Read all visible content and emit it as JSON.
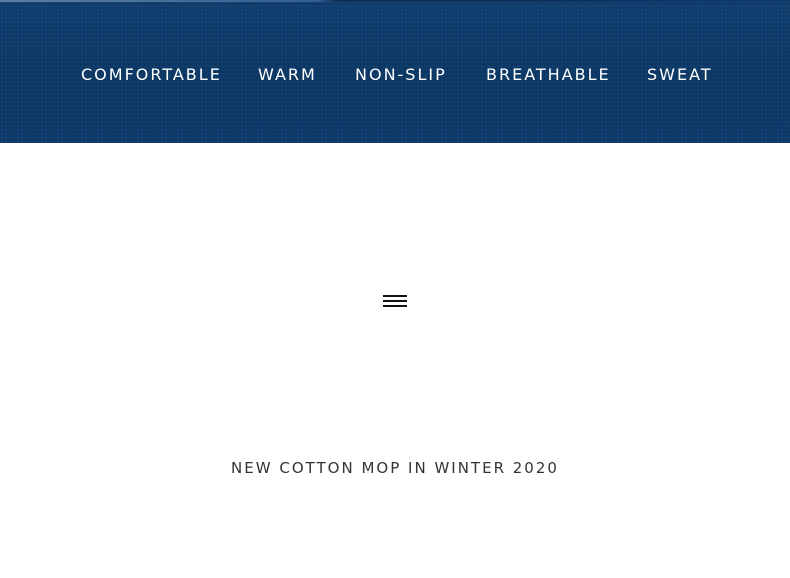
{
  "banner": {
    "background_color": "#0d3a6a",
    "features": [
      "COMFORTABLE",
      "WARM",
      "NON-SLIP",
      "BREATHABLE",
      "SWEAT"
    ]
  },
  "menu": {
    "icon": "hamburger-menu-icon"
  },
  "product": {
    "headline": "NEW COTTON MOP IN WINTER 2020"
  }
}
